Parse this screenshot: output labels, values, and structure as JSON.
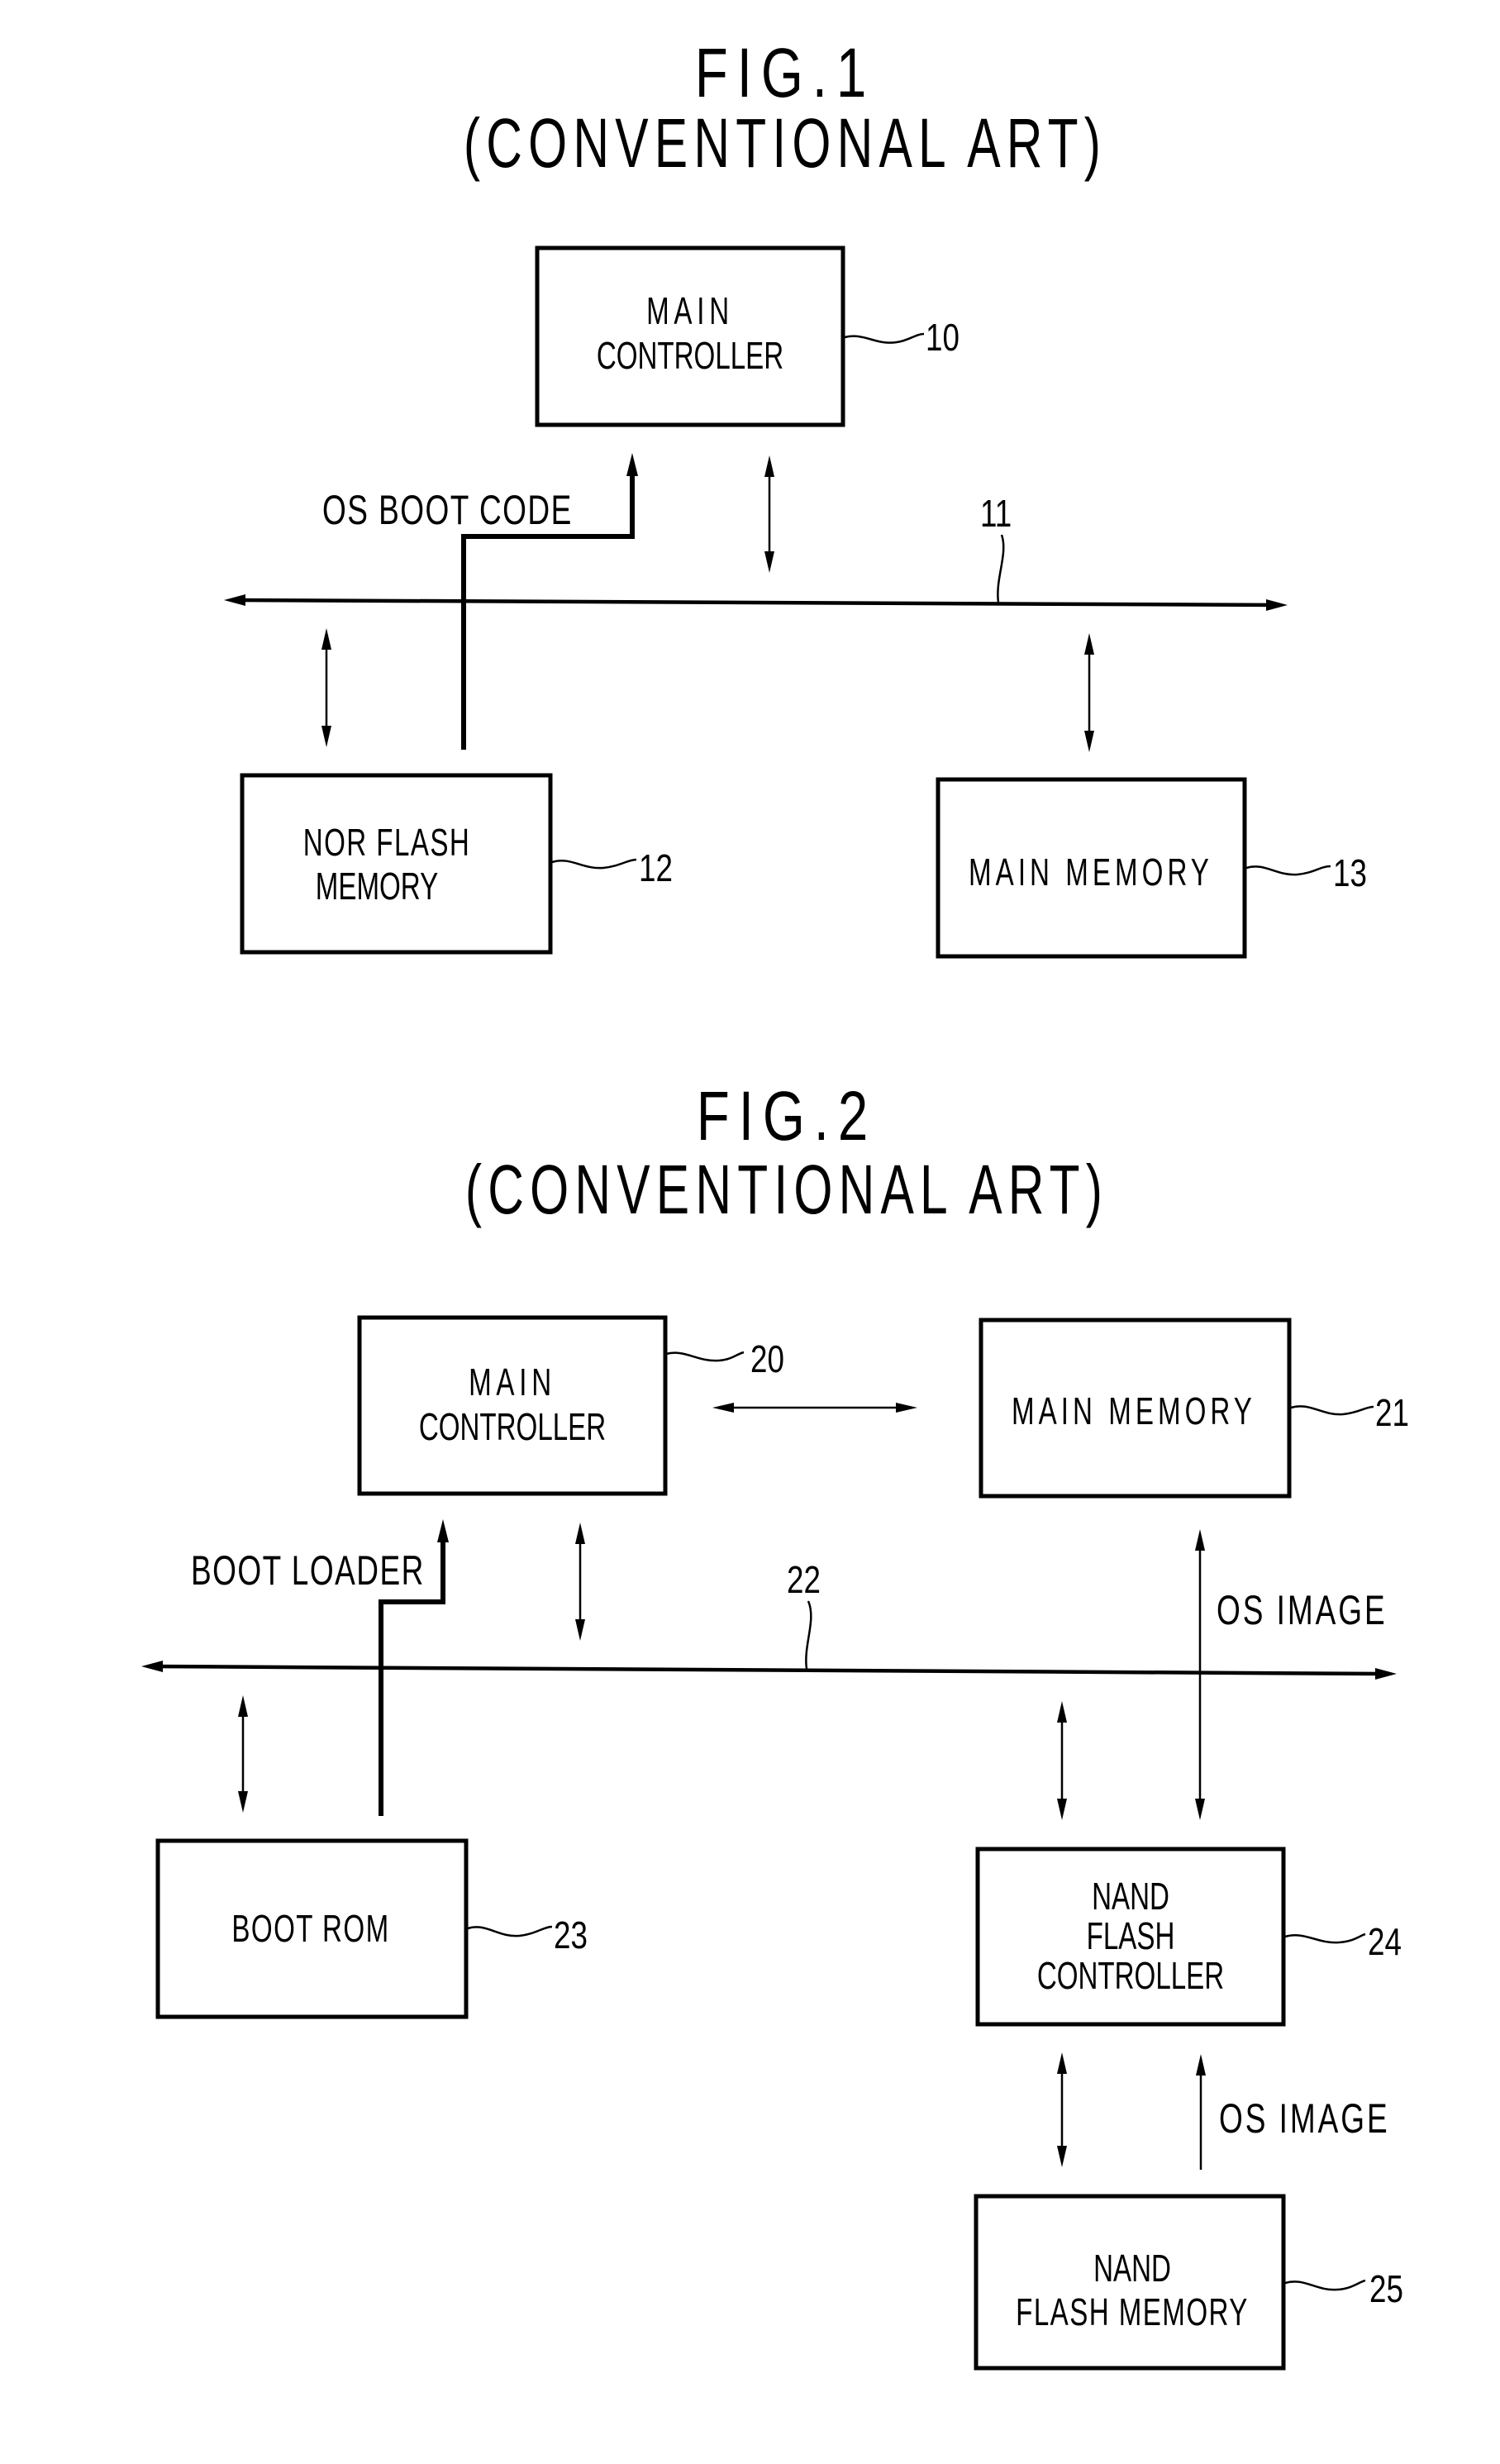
{
  "figures": [
    {
      "title": "FIG.1",
      "subtitle": "(CONVENTIONAL ART)",
      "blocks": {
        "main_controller": {
          "lines": [
            "MAIN",
            "CONTROLLER"
          ],
          "ref": "10"
        },
        "nor_flash": {
          "lines": [
            "NOR FLASH",
            "MEMORY"
          ],
          "ref": "12"
        },
        "main_memory": {
          "lines": [
            "MAIN MEMORY"
          ],
          "ref": "13"
        }
      },
      "bus": {
        "ref": "11"
      },
      "signals": {
        "boot_path": "OS BOOT CODE"
      }
    },
    {
      "title": "FIG.2",
      "subtitle": "(CONVENTIONAL ART)",
      "blocks": {
        "main_controller": {
          "lines": [
            "MAIN",
            "CONTROLLER"
          ],
          "ref": "20"
        },
        "main_memory": {
          "lines": [
            "MAIN MEMORY"
          ],
          "ref": "21"
        },
        "boot_rom": {
          "lines": [
            "BOOT ROM"
          ],
          "ref": "23"
        },
        "nand_controller": {
          "lines": [
            "NAND",
            "FLASH",
            "CONTROLLER"
          ],
          "ref": "24"
        },
        "nand_memory": {
          "lines": [
            "NAND",
            "FLASH MEMORY"
          ],
          "ref": "25"
        }
      },
      "bus": {
        "ref": "22"
      },
      "signals": {
        "boot_path": "BOOT LOADER",
        "os_image_upper": "OS IMAGE",
        "os_image_lower": "OS IMAGE"
      }
    }
  ]
}
